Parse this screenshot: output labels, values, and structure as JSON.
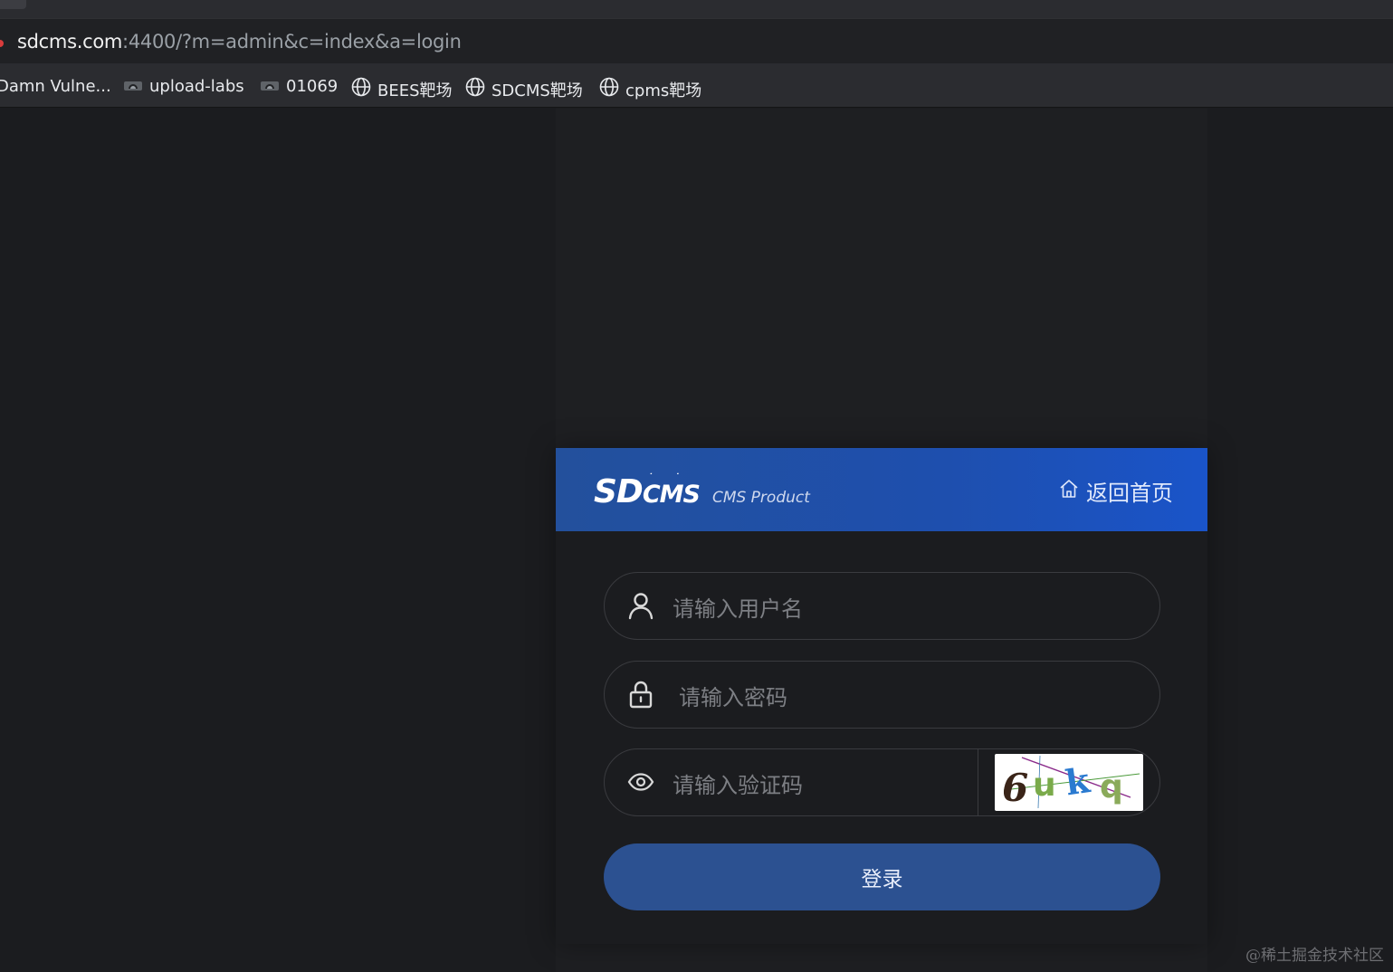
{
  "browser": {
    "url_host": "sdcms.com",
    "url_rest": ":4400/?m=admin&c=index&a=login",
    "bookmarks": [
      {
        "label": "Damn Vulne...",
        "icon": "none"
      },
      {
        "label": "upload-labs",
        "icon": "cloud-icon"
      },
      {
        "label": "01069",
        "icon": "cloud-icon"
      },
      {
        "label": "BEES靶场",
        "icon": "globe-icon"
      },
      {
        "label": "SDCMS靶场",
        "icon": "globe-icon"
      },
      {
        "label": "cpms靶场",
        "icon": "globe-icon"
      }
    ]
  },
  "login": {
    "logo_sd": "SD",
    "logo_cms": "CMS",
    "logo_product": "CMS Product",
    "home_link": "返回首页",
    "username_placeholder": "请输入用户名",
    "password_placeholder": "请输入密码",
    "captcha_placeholder": "请输入验证码",
    "captcha_text": "6ukq",
    "submit_label": "登录",
    "colors": {
      "header_start": "#23509c",
      "header_end": "#1a54c9",
      "button": "#2c5191"
    }
  },
  "watermark": "@稀土掘金技术社区"
}
